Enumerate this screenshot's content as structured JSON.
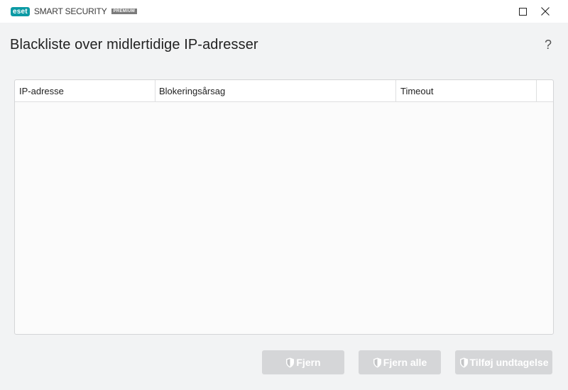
{
  "titlebar": {
    "logo_text": "eset",
    "product_name": "SMART SECURITY",
    "edition": "PREMIUM",
    "controls": [
      "maximize-icon",
      "close-icon"
    ]
  },
  "header": {
    "title": "Blackliste over midlertidige IP-adresser",
    "help_label": "?"
  },
  "table": {
    "columns": [
      "IP-adresse",
      "Blokeringsårsag",
      "Timeout"
    ],
    "rows": []
  },
  "actions": {
    "remove_label": "Fjern",
    "remove_all_label": "Fjern alle",
    "add_exception_label": "Tilføj undtagelse",
    "button_icon": "shield-icon"
  },
  "colors": {
    "brand": "#0b9aa4",
    "disabled_button": "#d5d6d8",
    "background": "#f2f3f4"
  }
}
